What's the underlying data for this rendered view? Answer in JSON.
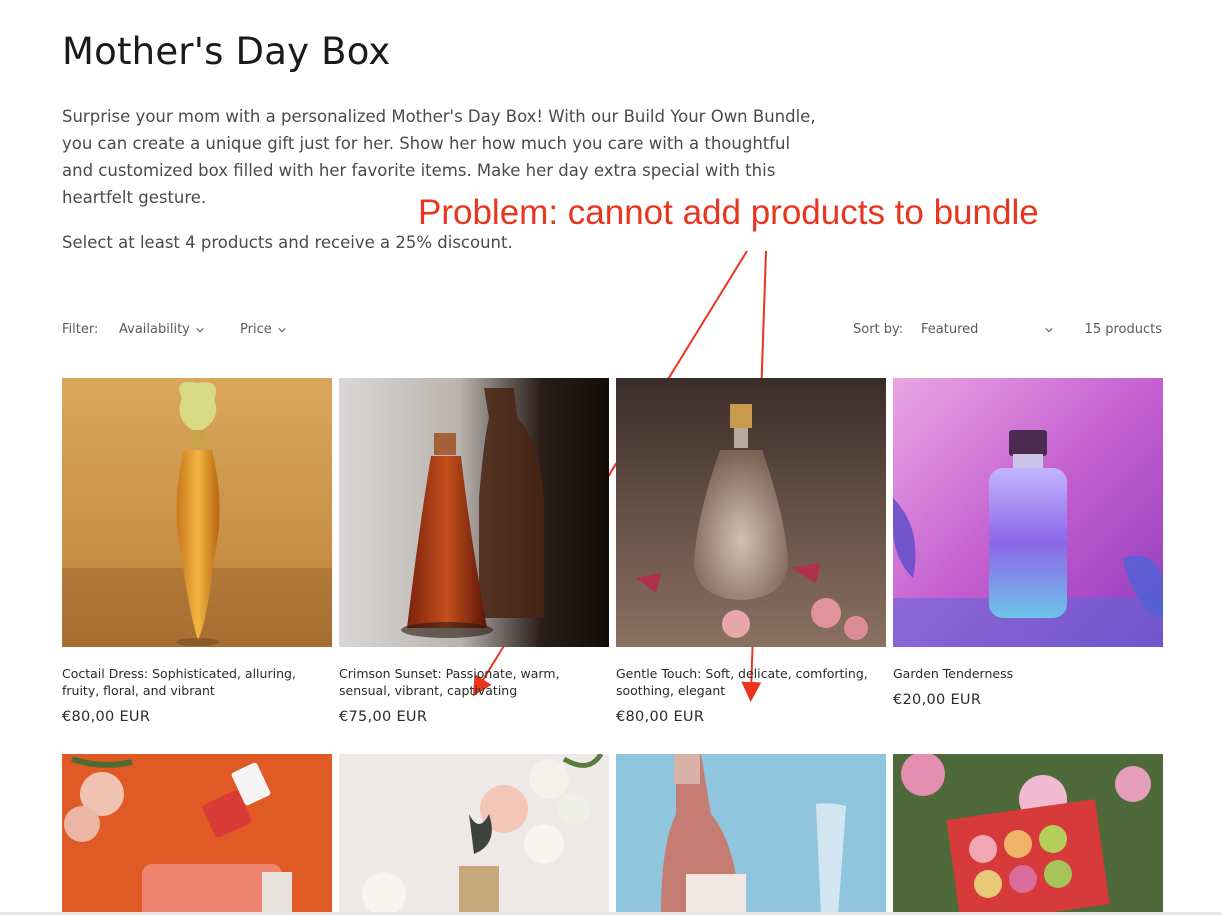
{
  "page": {
    "title": "Mother's Day Box",
    "description": "Surprise your mom with a personalized Mother's Day Box! With our Build Your Own Bundle, you can create a unique gift just for her. Show her how much you care with a thoughtful and customized box filled with her favorite items. Make her day extra special with this heartfelt gesture.",
    "discount_note": "Select at least 4 products and receive a 25% discount."
  },
  "annotation": {
    "text": "Problem: cannot add products to bundle",
    "color": "#e8351e"
  },
  "filters": {
    "label": "Filter:",
    "availability": "Availability",
    "price": "Price",
    "sort_label": "Sort by:",
    "sort_value": "Featured",
    "product_count": "15 products"
  },
  "products": [
    {
      "title": "Coctail Dress: Sophisticated, alluring, fruity, floral, and vibrant",
      "price": "€80,00 EUR"
    },
    {
      "title": "Crimson Sunset: Passionate, warm, sensual, vibrant, captivating",
      "price": "€75,00 EUR"
    },
    {
      "title": "Gentle Touch: Soft, delicate, comforting, soothing, elegant",
      "price": "€80,00 EUR"
    },
    {
      "title": "Garden Tenderness",
      "price": "€20,00 EUR"
    },
    {
      "title": "",
      "price": ""
    },
    {
      "title": "",
      "price": ""
    },
    {
      "title": "",
      "price": ""
    },
    {
      "title": "",
      "price": ""
    }
  ]
}
